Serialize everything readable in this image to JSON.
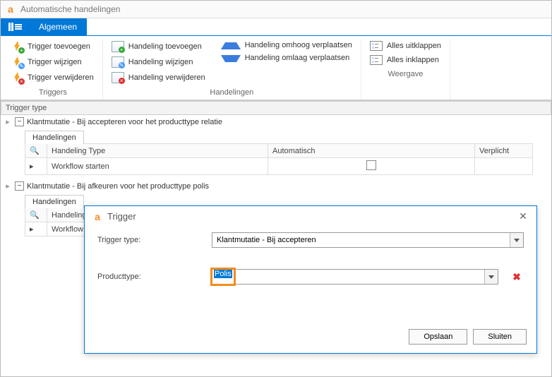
{
  "window": {
    "title": "Automatische handelingen"
  },
  "tabs": {
    "general": "Algemeen"
  },
  "ribbon": {
    "triggers": {
      "label": "Triggers",
      "add": "Trigger toevoegen",
      "edit": "Trigger wijzigen",
      "del": "Trigger verwijderen"
    },
    "actions": {
      "label": "Handelingen",
      "add": "Handeling toevoegen",
      "edit": "Handeling wijzigen",
      "del": "Handeling verwijderen",
      "moveUp": "Handeling omhoog verplaatsen",
      "moveDown": "Handeling omlaag verplaatsen"
    },
    "view": {
      "label": "Weergave",
      "expand": "Alles uitklappen",
      "collapse": "Alles inklappen"
    }
  },
  "grid": {
    "header": "Trigger type",
    "sub": {
      "tab": "Handelingen",
      "colType": "Handeling Type",
      "colAuto": "Automatisch",
      "colReq": "Verplicht"
    },
    "rows": [
      {
        "title": "Klantmutatie - Bij accepteren voor het producttype relatie",
        "action": "Workflow starten"
      },
      {
        "title": "Klantmutatie - Bij afkeuren voor het producttype polis",
        "action": "Workflow st"
      }
    ]
  },
  "dialog": {
    "title": "Trigger",
    "typeLabel": "Trigger type:",
    "typeValue": "Klantmutatie - Bij accepteren",
    "productLabel": "Producttype:",
    "productValue": "Polis",
    "save": "Opslaan",
    "close": "Sluiten"
  }
}
